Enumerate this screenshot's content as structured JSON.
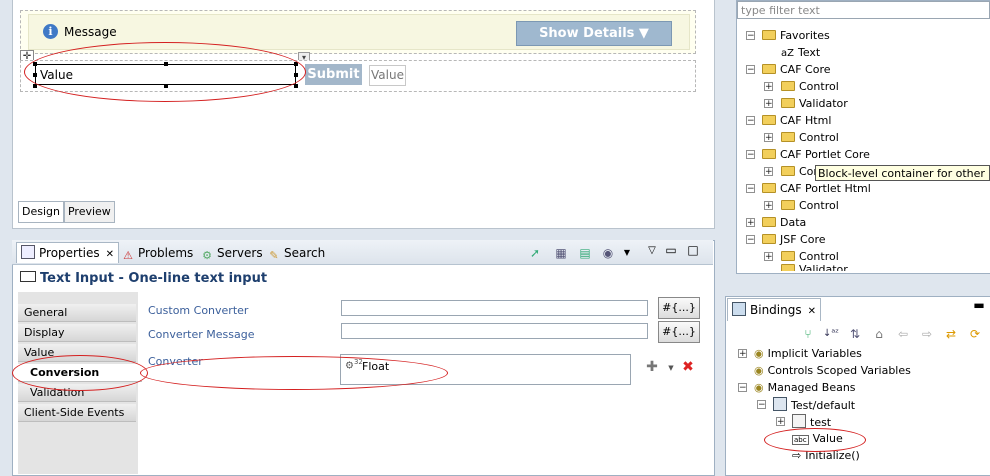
{
  "design": {
    "message_label": "Message",
    "show_details_label": "Show Details ▼",
    "value_input_value": "Value",
    "submit_label": "Submit",
    "value_output": "Value",
    "tabs": [
      "Design",
      "Preview"
    ]
  },
  "properties": {
    "tabs": [
      "Properties",
      "Problems",
      "Servers",
      "Search"
    ],
    "title": "Text Input - One-line text input",
    "side_tabs": [
      "General",
      "Display",
      "Value",
      "Conversion",
      "Validation",
      "Client-Side Events"
    ],
    "active_side_tab": "Conversion",
    "fields": {
      "custom_converter_label": "Custom Converter",
      "converter_message_label": "Converter Message",
      "converter_label": "Converter",
      "expr_button": "#{...}",
      "converter_value": "Float"
    }
  },
  "palette": {
    "filter_placeholder": "type filter text",
    "tree": [
      {
        "label": "Favorites",
        "level": 0,
        "state": "-"
      },
      {
        "label": "Text",
        "level": 1,
        "state": "",
        "icon": "aZ"
      },
      {
        "label": "CAF Core",
        "level": 0,
        "state": "-"
      },
      {
        "label": "Control",
        "level": 1,
        "state": "+"
      },
      {
        "label": "Validator",
        "level": 1,
        "state": "+"
      },
      {
        "label": "CAF Html",
        "level": 0,
        "state": "-"
      },
      {
        "label": "Control",
        "level": 1,
        "state": "+"
      },
      {
        "label": "CAF Portlet Core",
        "level": 0,
        "state": "-"
      },
      {
        "label": "Cor",
        "level": 1,
        "state": "+"
      },
      {
        "label": "CAF Portlet Html",
        "level": 0,
        "state": "-"
      },
      {
        "label": "Control",
        "level": 1,
        "state": "+"
      },
      {
        "label": "Data",
        "level": 0,
        "state": "+"
      },
      {
        "label": "JSF Core",
        "level": 0,
        "state": "-"
      },
      {
        "label": "Control",
        "level": 1,
        "state": "+"
      },
      {
        "label": "Validator",
        "level": 1,
        "state": "+"
      }
    ],
    "tooltip": "Block-level container for other comp"
  },
  "bindings": {
    "tab_label": "Bindings",
    "tree": [
      {
        "label": "Implicit Variables",
        "level": 0,
        "state": "+"
      },
      {
        "label": "Controls Scoped Variables",
        "level": 0,
        "state": ""
      },
      {
        "label": "Managed Beans",
        "level": 0,
        "state": "-"
      },
      {
        "label": "Test/default",
        "level": 1,
        "state": "-"
      },
      {
        "label": "test",
        "level": 2,
        "state": "+"
      },
      {
        "label": "Value",
        "level": 2,
        "state": ""
      },
      {
        "label": "Initialize()",
        "level": 2,
        "state": ""
      }
    ]
  }
}
